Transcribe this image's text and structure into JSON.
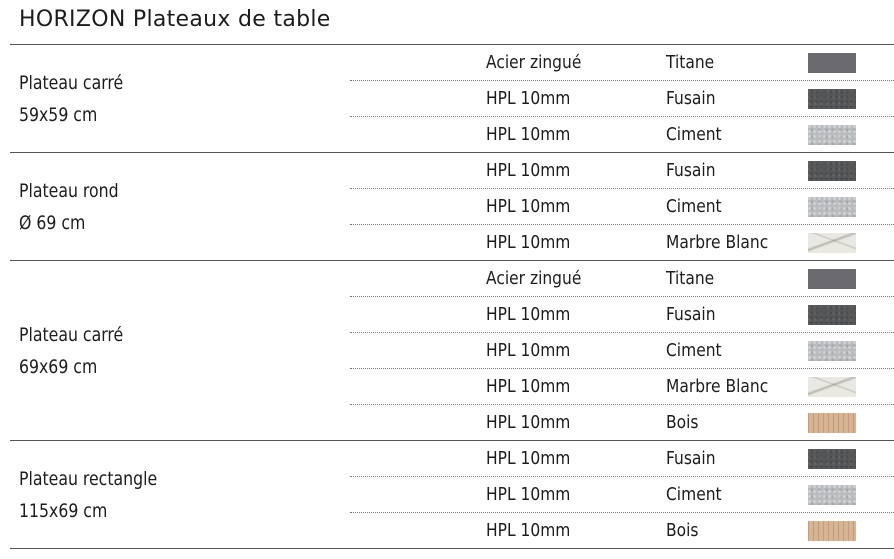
{
  "title": "HORIZON Plateaux de table",
  "groups": [
    {
      "name": "Plateau carré",
      "size": "59x59 cm",
      "rows": [
        {
          "material": "Acier zingué",
          "finish": "Titane",
          "swatch": "titane"
        },
        {
          "material": "HPL 10mm",
          "finish": "Fusain",
          "swatch": "fusain"
        },
        {
          "material": "HPL 10mm",
          "finish": "Ciment",
          "swatch": "ciment"
        }
      ]
    },
    {
      "name": "Plateau rond",
      "size": "Ø 69 cm",
      "rows": [
        {
          "material": "HPL 10mm",
          "finish": "Fusain",
          "swatch": "fusain"
        },
        {
          "material": "HPL 10mm",
          "finish": "Ciment",
          "swatch": "ciment"
        },
        {
          "material": "HPL 10mm",
          "finish": "Marbre Blanc",
          "swatch": "marbre"
        }
      ]
    },
    {
      "name": "Plateau carré",
      "size": "69x69 cm",
      "rows": [
        {
          "material": "Acier zingué",
          "finish": "Titane",
          "swatch": "titane"
        },
        {
          "material": "HPL 10mm",
          "finish": "Fusain",
          "swatch": "fusain"
        },
        {
          "material": "HPL 10mm",
          "finish": "Ciment",
          "swatch": "ciment"
        },
        {
          "material": "HPL 10mm",
          "finish": "Marbre Blanc",
          "swatch": "marbre"
        },
        {
          "material": "HPL 10mm",
          "finish": "Bois",
          "swatch": "bois"
        }
      ]
    },
    {
      "name": "Plateau rectangle",
      "size": "115x69 cm",
      "rows": [
        {
          "material": "HPL 10mm",
          "finish": "Fusain",
          "swatch": "fusain"
        },
        {
          "material": "HPL 10mm",
          "finish": "Ciment",
          "swatch": "ciment"
        },
        {
          "material": "HPL 10mm",
          "finish": "Bois",
          "swatch": "bois"
        }
      ]
    }
  ],
  "swatch_colors": {
    "titane": "#6b6a70",
    "fusain": "#555759",
    "ciment": "#b9bcbf",
    "marbre": "#e9e8e2",
    "bois": "#d7b594"
  }
}
